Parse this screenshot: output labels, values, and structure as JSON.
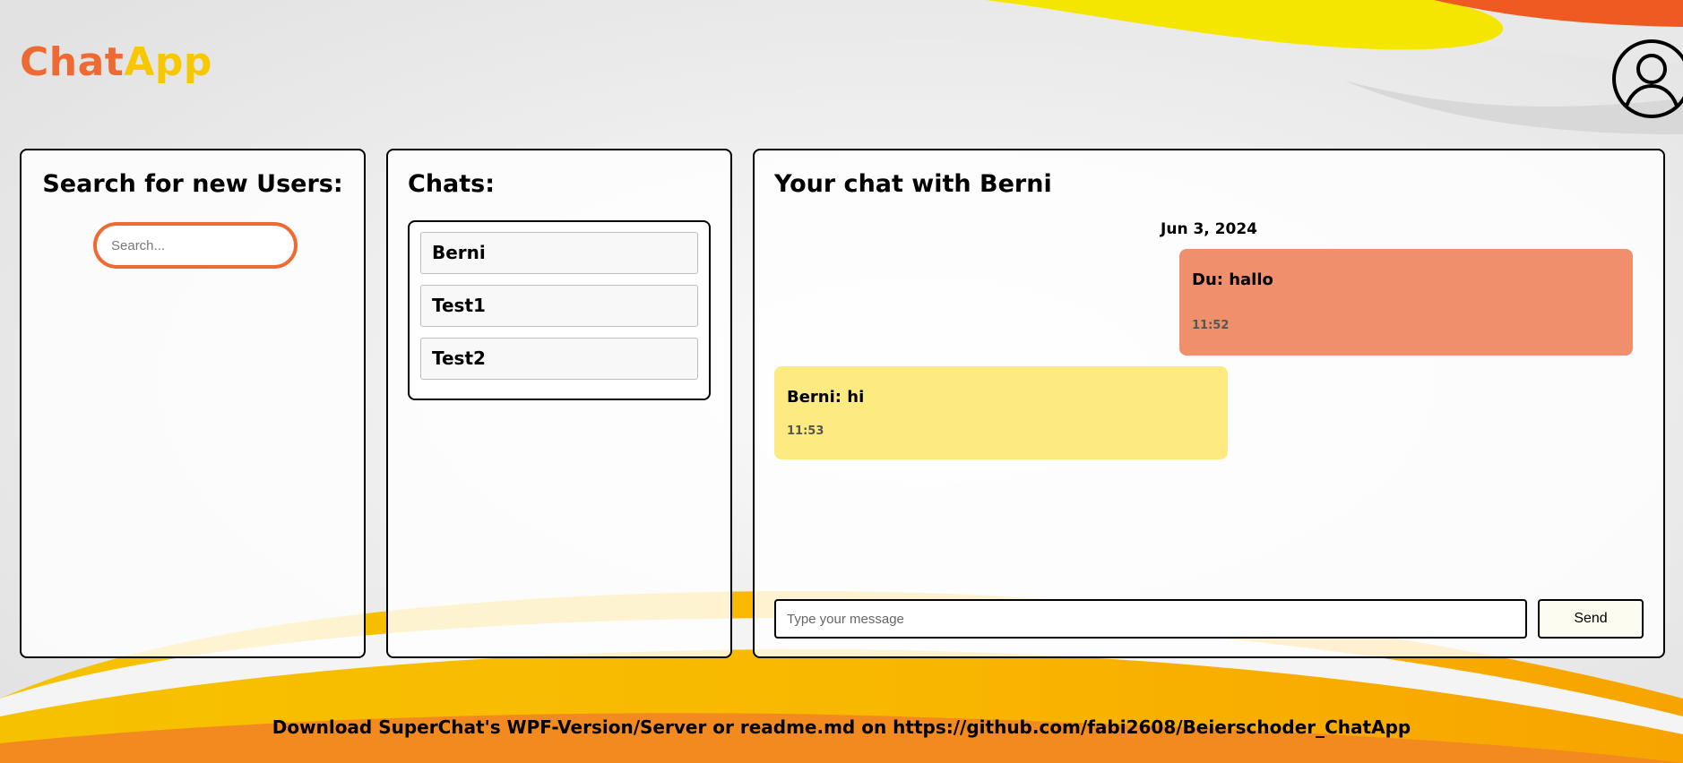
{
  "app": {
    "logo_part1": "Chat",
    "logo_part2": "App",
    "profile_icon": "user-circle-icon"
  },
  "search_panel": {
    "title": "Search for new Users:",
    "placeholder": "Search..."
  },
  "chats_panel": {
    "title": "Chats:",
    "items": [
      {
        "label": "Berni"
      },
      {
        "label": "Test1"
      },
      {
        "label": "Test2"
      }
    ]
  },
  "chat_panel": {
    "title": "Your chat with Berni",
    "date": "Jun 3, 2024",
    "messages": [
      {
        "text": "Du: hallo",
        "time": "11:52",
        "direction": "outgoing"
      },
      {
        "text": "Berni: hi",
        "time": "11:53",
        "direction": "incoming"
      }
    ],
    "input_placeholder": "Type your message",
    "send_label": "Send"
  },
  "footer": {
    "text": "Download SuperChat's WPF-Version/Server or readme.md on https://github.com/fabi2608/Beierschoder_ChatApp"
  },
  "colors": {
    "orange": "#ee6a33",
    "yellow": "#f7c800",
    "outgoing_bubble": "#f08f6c",
    "incoming_bubble": "#fdea80"
  }
}
